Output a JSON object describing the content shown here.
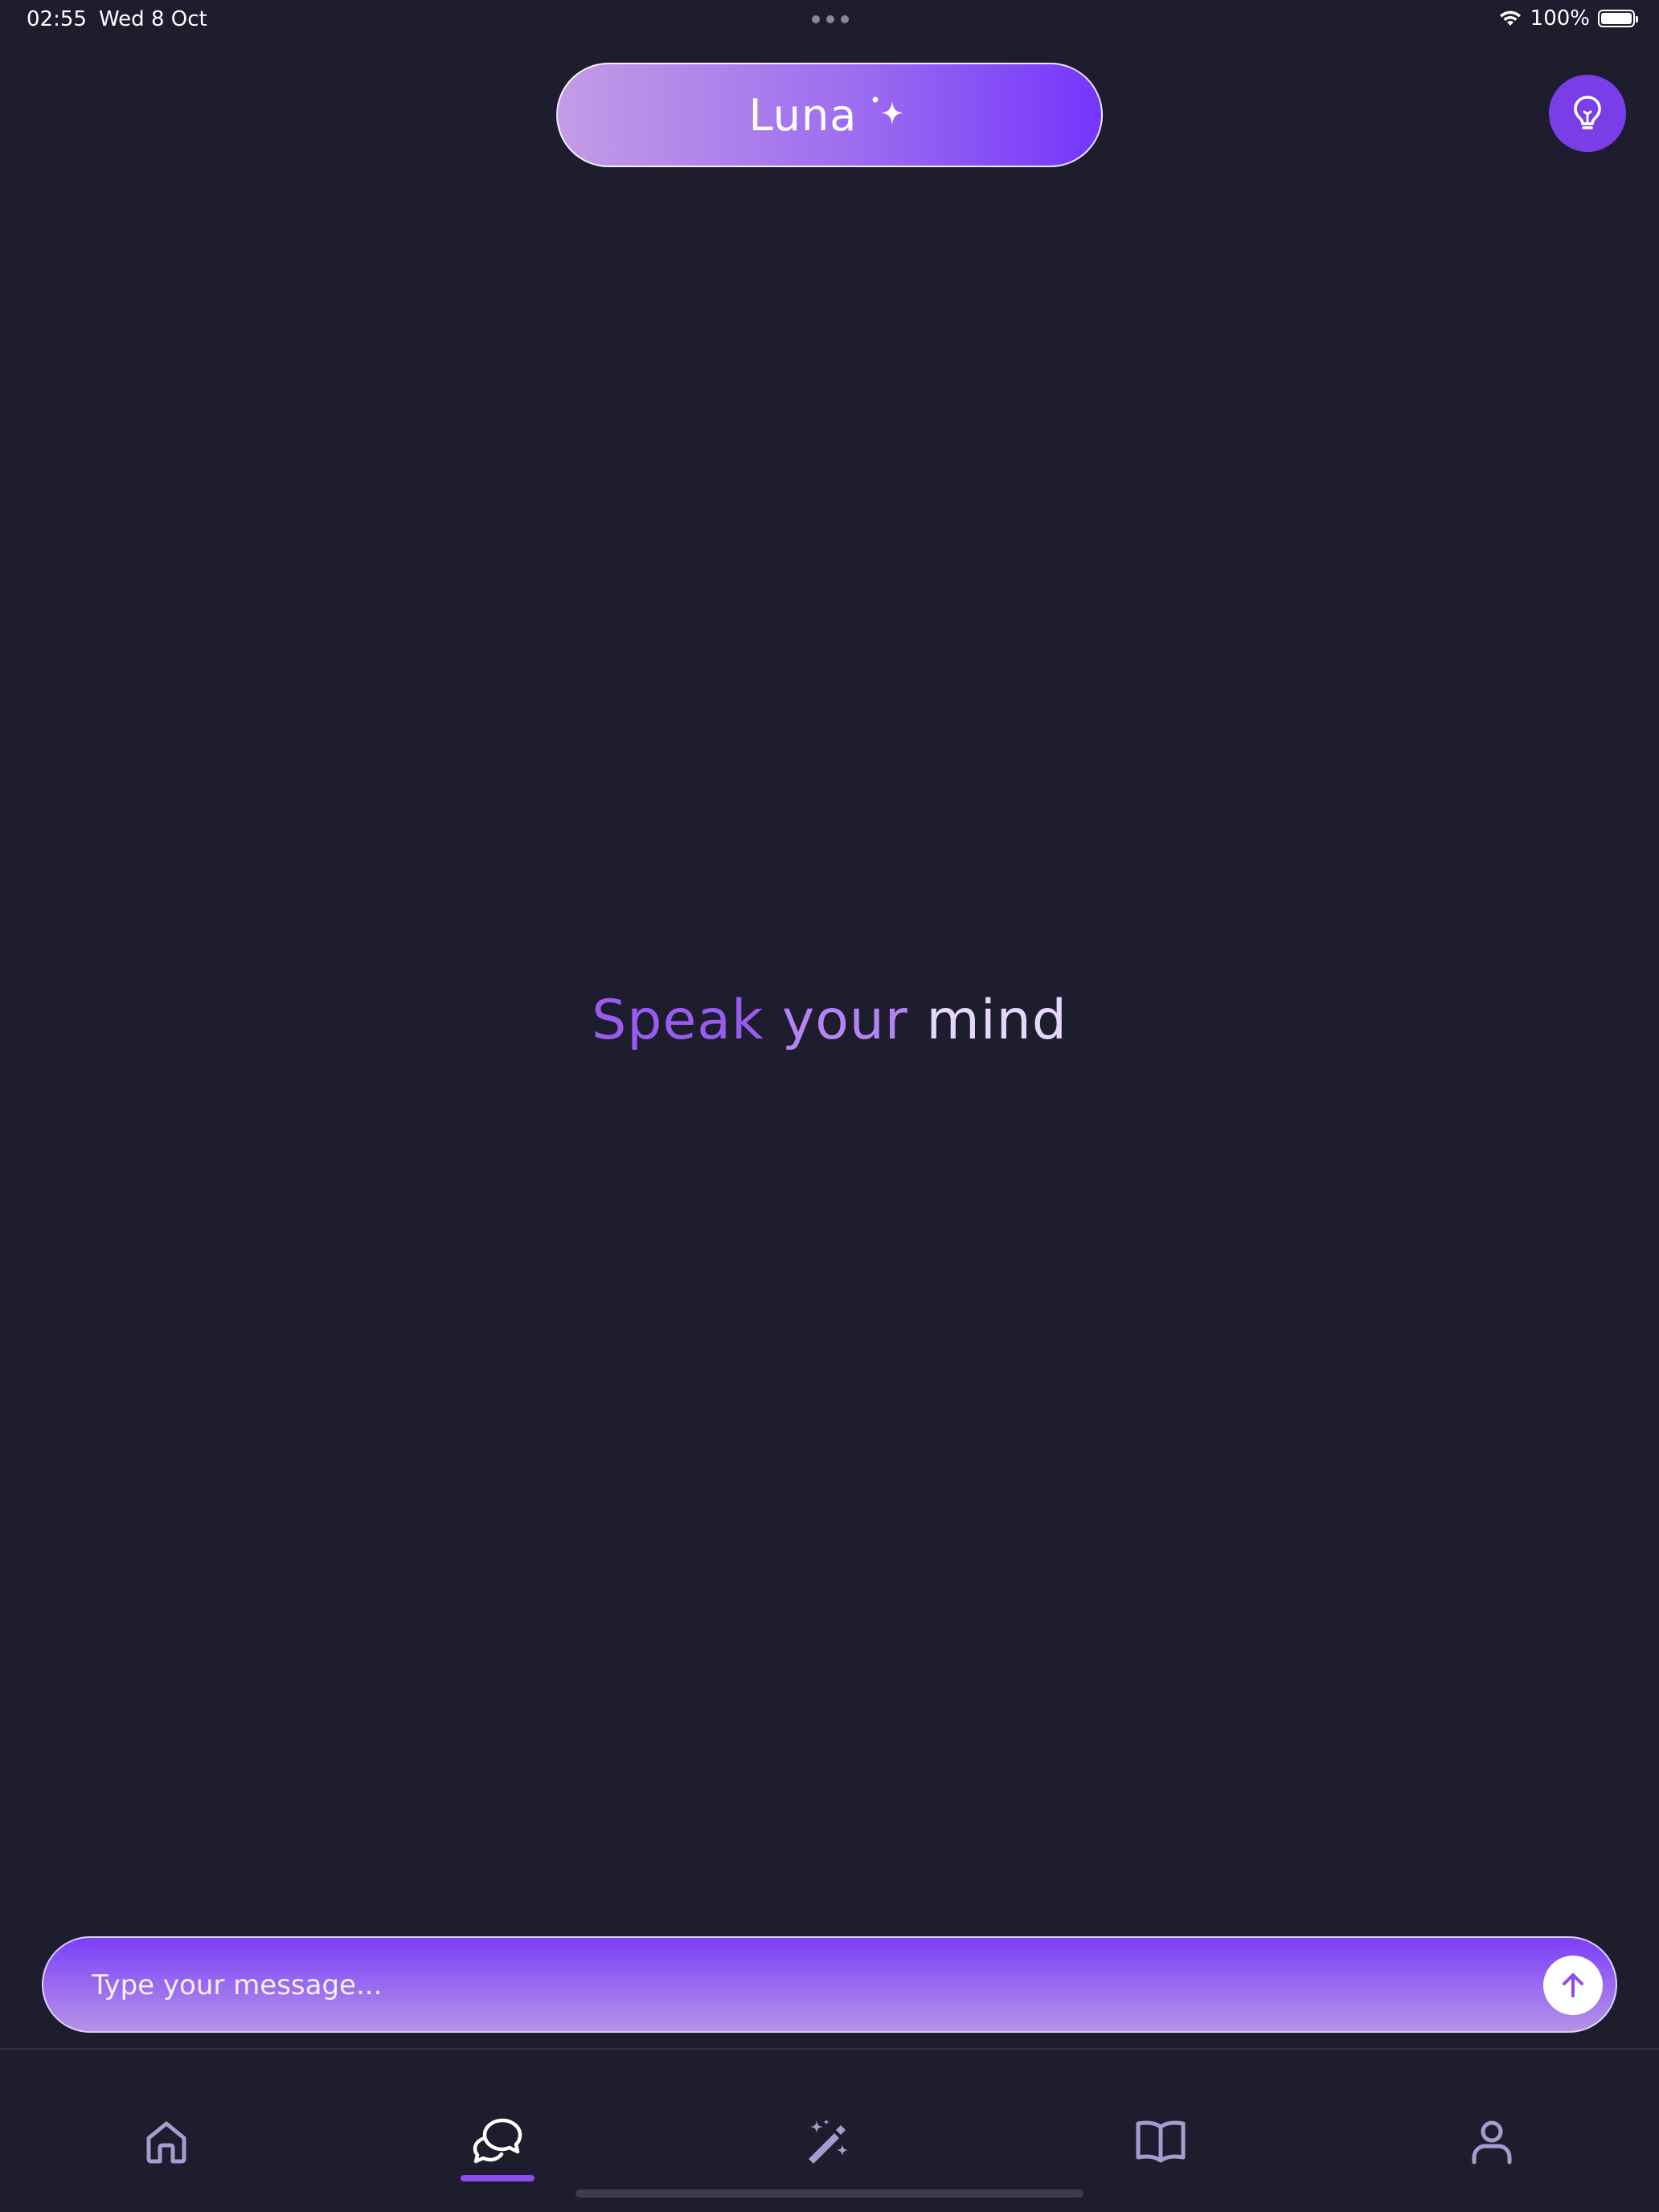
{
  "status_bar": {
    "time": "02:55",
    "date": "Wed 8 Oct",
    "battery_percent": "100%",
    "battery_level": 1.0
  },
  "header": {
    "title": "Luna",
    "title_icon": "sparkle-icon"
  },
  "help_button": {
    "icon": "lightbulb-icon"
  },
  "headline": {
    "word1": "Speak",
    "word2": "your",
    "word3": "mind"
  },
  "composer": {
    "placeholder": "Type your message...",
    "value": "",
    "send_icon": "arrow-up-icon"
  },
  "bottom_nav": {
    "items": [
      {
        "id": "home",
        "icon": "home-icon"
      },
      {
        "id": "chat",
        "icon": "chat-bubbles-icon",
        "active": true
      },
      {
        "id": "magic",
        "icon": "magic-wand-icon"
      },
      {
        "id": "journal",
        "icon": "book-icon"
      },
      {
        "id": "profile",
        "icon": "user-icon"
      }
    ]
  },
  "colors": {
    "background": "#1e1d2d",
    "accent": "#7a3ee9",
    "accent_light": "#c39ce6",
    "nav_icon": "#a89bd0",
    "nav_icon_active": "#ffffff"
  }
}
